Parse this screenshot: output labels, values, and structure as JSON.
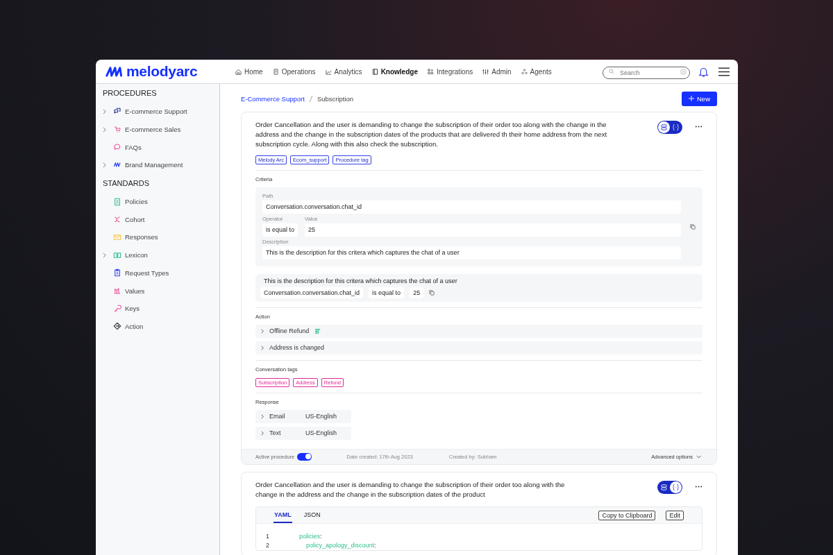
{
  "app": {
    "logo": "melodyarc"
  },
  "nav": [
    {
      "label": "Home",
      "selected": false
    },
    {
      "label": "Operations",
      "selected": false
    },
    {
      "label": "Analytics",
      "selected": false
    },
    {
      "label": "Knowledge",
      "selected": true
    },
    {
      "label": "Integrations",
      "selected": false
    },
    {
      "label": "Admin",
      "selected": false
    },
    {
      "label": "Agents",
      "selected": false
    }
  ],
  "search": {
    "placeholder": "Search"
  },
  "sidebar": {
    "sections": [
      {
        "title": "PROCEDURES",
        "items": [
          {
            "label": "E-commerce Support",
            "kind": "group"
          },
          {
            "label": "E-commerce Sales",
            "kind": "group"
          },
          {
            "label": "FAQs",
            "kind": "leaf"
          },
          {
            "label": "Brand Management",
            "kind": "group"
          }
        ]
      },
      {
        "title": "STANDARDS",
        "items": [
          {
            "label": "Policies",
            "kind": "leaf"
          },
          {
            "label": "Cohort",
            "kind": "leaf"
          },
          {
            "label": "Responses",
            "kind": "leaf"
          },
          {
            "label": "Lexicon",
            "kind": "group"
          },
          {
            "label": "Request Types",
            "kind": "leaf"
          },
          {
            "label": "Values",
            "kind": "leaf"
          },
          {
            "label": "Keys",
            "kind": "leaf"
          },
          {
            "label": "Action",
            "kind": "leaf"
          }
        ]
      }
    ]
  },
  "breadcrumb": [
    {
      "label": "E-Commerce Support",
      "selected": false
    },
    {
      "label": "Subscription",
      "selected": true
    }
  ],
  "new_button": {
    "label": "New"
  },
  "cards": [
    {
      "kind": "detail",
      "title": "Order Cancellation and the user is demanding to change the subscription of their order too along with the change in the address and the change in the subscription dates of the products that are delivered th their home address from the next subscription cycle. Along with this also check the subscription.",
      "view": [
        {
          "selected": true
        },
        {
          "selected": false
        }
      ],
      "tags": [
        "Melody Arc",
        "Ecom_support",
        "Procedure tag"
      ],
      "criteria": {
        "label": "Criteria",
        "path_label": "Path",
        "path": "Conversation.conversation.chat_id",
        "operator_label": "Operator",
        "operator": "is equal to",
        "value_label": "Value",
        "value": "25",
        "description_label": "Description",
        "description": "This is the description for this critera which captures the chat of a user",
        "summary": {
          "description": "This is the description for this critera which captures the chat of a user",
          "path": "Conversation.conversation.chat_id",
          "operator": "is equal to",
          "value": "25"
        }
      },
      "action": {
        "label": "Action",
        "items": [
          {
            "label": "Offline Refund",
            "kind": "with_icon"
          },
          {
            "label": "Address is changed",
            "kind": "plain"
          }
        ]
      },
      "conversation_tags": {
        "label": "Conversation tags",
        "tags": [
          "Subscription",
          "Address",
          "Refund"
        ]
      },
      "response": {
        "label": "Response",
        "items": [
          {
            "channel": "Email",
            "locale": "US-English"
          },
          {
            "channel": "Text",
            "locale": "US-English"
          }
        ]
      },
      "footer": {
        "active_label": "Active procedure",
        "active": true,
        "date_created": "Date created: 17th Aug 2023",
        "created_by": "Created by: Subham",
        "advanced": "Advanced options"
      }
    },
    {
      "kind": "code",
      "title": "Order Cancellation and the user is demanding to change the subscription of their order too along with the change in the address and the change in the subscription dates of the product",
      "view": [
        {
          "selected": false
        },
        {
          "selected": true
        }
      ],
      "tabs": [
        {
          "label": "YAML",
          "selected": true
        },
        {
          "label": "JSON",
          "selected": false
        }
      ],
      "copy": "Copy to Clipboard",
      "edit": "Edit",
      "lines": [
        {
          "number": "1",
          "text": "policies:"
        },
        {
          "number": "2",
          "text": "    policy_apology_discount:"
        }
      ]
    }
  ]
}
